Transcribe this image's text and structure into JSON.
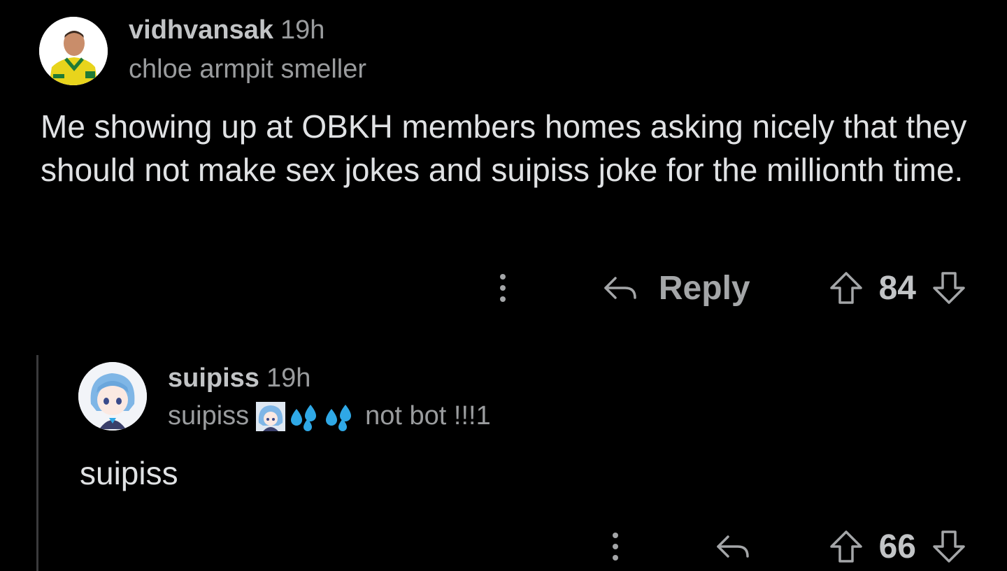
{
  "comments": [
    {
      "username": "vidhvansak",
      "time": "19h",
      "flair": "chloe armpit smeller",
      "body": "Me showing up at OBKH members homes asking nicely that they should not make sex jokes and suipiss joke for the millionth time.",
      "reply_label": "Reply",
      "score": "84"
    },
    {
      "username": "suipiss",
      "time": "19h",
      "flair_prefix": "suipiss",
      "flair_emojis": [
        "anime-girl-emoji",
        "sweat-droplets-emoji",
        "sweat-droplets-emoji"
      ],
      "flair_suffix": "not bot !!!1",
      "body": "suipiss",
      "score": "66"
    }
  ],
  "colors": {
    "background": "#000000",
    "username": "#c2c4c6",
    "meta": "#9a9c9e",
    "body": "#e0e2e4",
    "icons": "#a4a6a8",
    "droplets": "#2fa8e6"
  },
  "icons": [
    "more-options-icon",
    "reply-arrow-icon",
    "upvote-icon",
    "downvote-icon"
  ]
}
